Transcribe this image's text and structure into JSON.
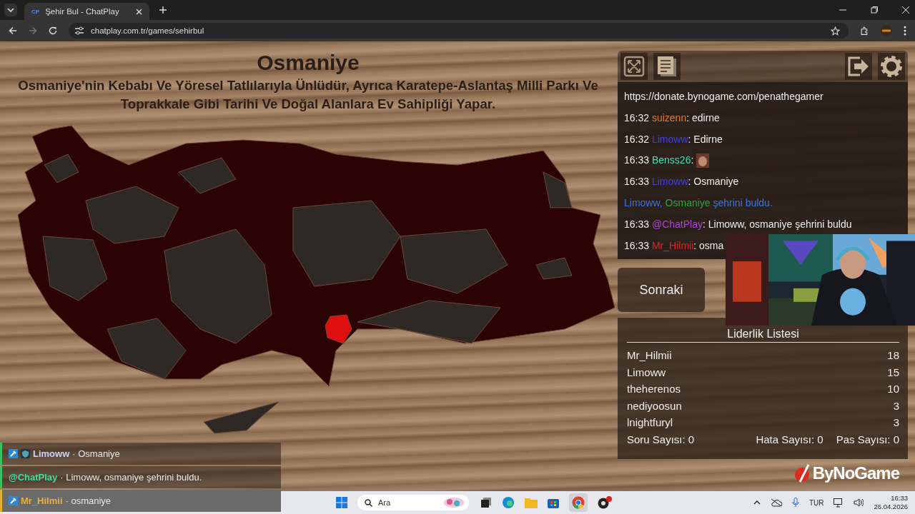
{
  "browser": {
    "tabs": [
      {
        "favicon": "CP",
        "title": "Şehir Bul - ChatPlay",
        "selected": true
      }
    ],
    "url": "chatplay.com.tr/games/sehirbul",
    "forward_disabled": true
  },
  "game": {
    "title": "Osmaniye",
    "description": "Osmaniye'nin Kebabı Ve Yöresel Tatlılarıyla Ünlüdür, Ayrıca Karatepe-Aslantaş Milli Parkı Ve Toprakkale Gibi Tarihi Ve Doğal Alanlara Ev Sahipliği Yapar."
  },
  "chat": {
    "messages": [
      {
        "kind": "url",
        "text": "https://donate.bynogame.com/penathegamer"
      },
      {
        "kind": "message",
        "time": "16:32",
        "user": "suizenn",
        "color": "#e07a30",
        "text": ": edirne"
      },
      {
        "kind": "message",
        "time": "16:32",
        "user": "Limoww",
        "color": "#4040d8",
        "text": ": Edirne"
      },
      {
        "kind": "emote",
        "time": "16:33",
        "user": "Benss26",
        "color": "#40e0b8",
        "text": ":"
      },
      {
        "kind": "message",
        "time": "16:33",
        "user": "Limoww",
        "color": "#4040d8",
        "text": ": Osmaniye"
      },
      {
        "kind": "system",
        "parts": [
          {
            "text": "Limoww,",
            "color": "#3a74e0"
          },
          {
            "text": "Osmaniye",
            "color": "#2fa43a"
          },
          {
            "text": "şehrini buldu.",
            "color": "#3a74e0"
          }
        ]
      },
      {
        "kind": "message",
        "time": "16:33",
        "user": "@ChatPlay",
        "color": "#b040e0",
        "text": ": Limoww, osmaniye şehrini buldu"
      },
      {
        "kind": "message",
        "time": "16:33",
        "user": "Mr_Hilmii",
        "color": "#e02424",
        "text": ": osma"
      }
    ]
  },
  "next_button": "Sonraki",
  "leaderboard": {
    "title": "Liderlik Listesi",
    "rows": [
      {
        "name": "Mr_Hilmii",
        "score": "18"
      },
      {
        "name": "Limoww",
        "score": "15"
      },
      {
        "name": "theherenos",
        "score": "10"
      },
      {
        "name": "nediyoosun",
        "score": "3"
      },
      {
        "name": "lnightfuryl",
        "score": "3"
      }
    ],
    "stats": [
      "Soru Sayısı: 0",
      "Hata Sayısı: 0",
      "Pas Sayısı: 0"
    ]
  },
  "overlay_chat": [
    {
      "mod_badge": true,
      "shield_badge": true,
      "user": "Limoww",
      "color": "#c8d4ff",
      "text": "· Osmaniye",
      "highlighted": false
    },
    {
      "mod_badge": false,
      "shield_badge": false,
      "user": "@ChatPlay",
      "color": "#3ee0a0",
      "text": "· Limoww, osmaniye şehrini buldu.",
      "highlighted": false
    },
    {
      "mod_badge": true,
      "shield_badge": false,
      "user": "Mr_Hilmii",
      "color": "#f0b030",
      "text": "· osmaniye",
      "highlighted": true
    }
  ],
  "logo": {
    "text": "ByNoGame"
  },
  "taskbar": {
    "search_placeholder": "Ara",
    "language": "TUR",
    "time": "16:33",
    "date": "26.04.2026"
  }
}
